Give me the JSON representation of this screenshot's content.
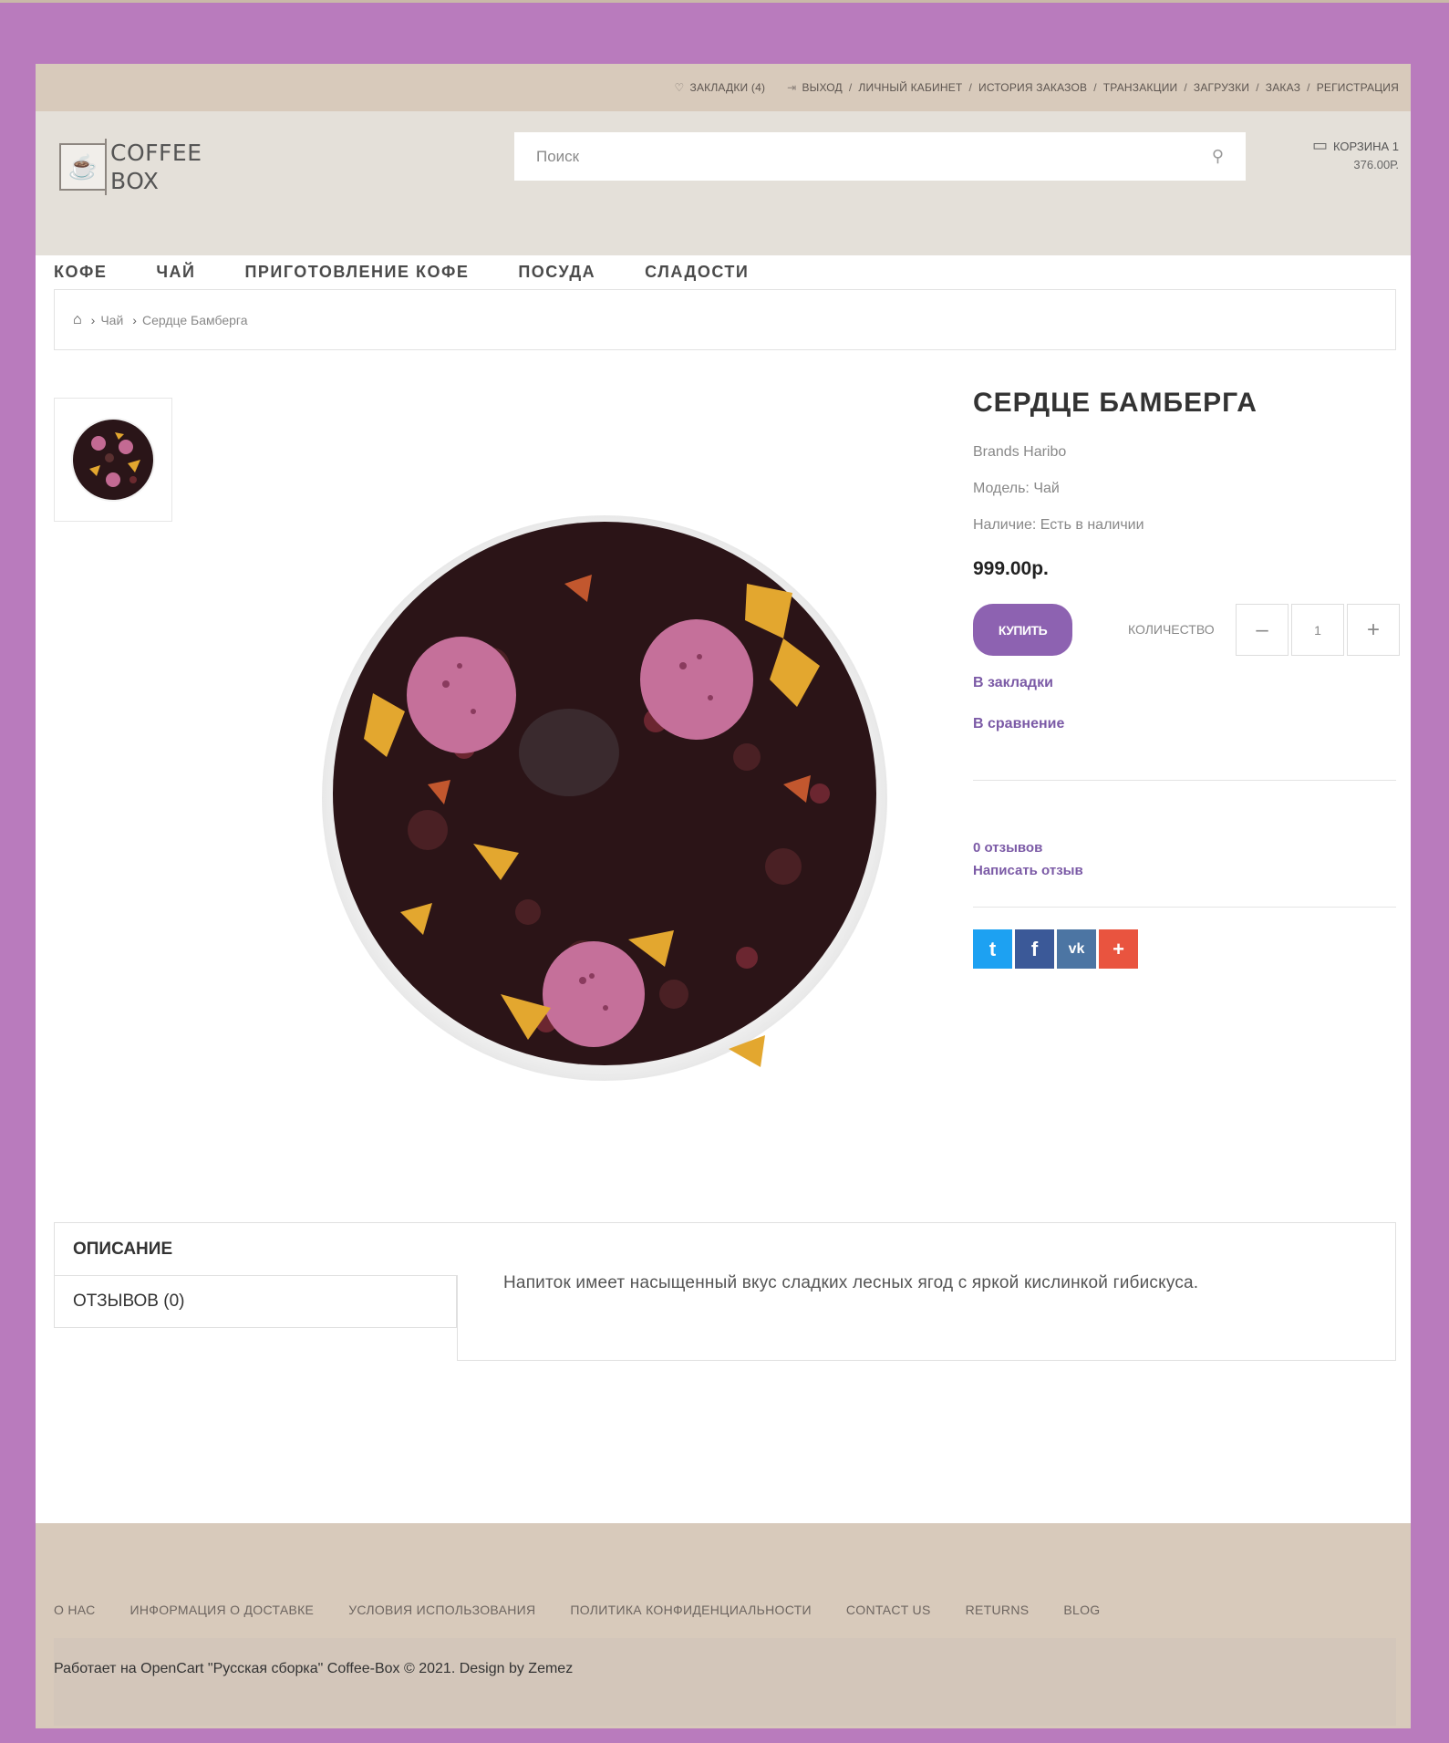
{
  "topbar": {
    "bookmarks": "ЗАКЛАДКИ (4)",
    "logout": "ВЫХОД",
    "account": "ЛИЧНЫЙ КАБИНЕТ",
    "orders": "ИСТОРИЯ ЗАКАЗОВ",
    "transactions": "ТРАНЗАКЦИИ",
    "downloads": "ЗАГРУЗКИ",
    "checkout": "ЗАКАЗ",
    "register": "РЕГИСТРАЦИЯ",
    "separator": "/"
  },
  "header": {
    "logo_line1": "COFFEE",
    "logo_line2": "BOX",
    "search_placeholder": "Поиск",
    "cart_label": "КОРЗИНА 1",
    "cart_total": "376.00Р."
  },
  "nav": [
    "КОФЕ",
    "ЧАЙ",
    "ПРИГОТОВЛЕНИЕ КОФЕ",
    "ПОСУДА",
    "СЛАДОСТИ"
  ],
  "breadcrumb": {
    "category": "Чай",
    "current": "Сердце Бамберга"
  },
  "product": {
    "title": "СЕРДЦЕ БАМБЕРГА",
    "brand": "Brands Haribo",
    "model": "Модель: Чай",
    "availability": "Наличие: Есть в наличии",
    "price": "999.00р.",
    "buy_label": "купить",
    "qty_label": "КОЛИЧЕСТВО",
    "qty_value": "1",
    "qty_minus": "–",
    "qty_plus": "+",
    "wishlist": "В закладки",
    "compare": "В сравнение",
    "reviews_count": "0 отзывов",
    "write_review": "Написать отзыв"
  },
  "social": {
    "twitter": "t",
    "facebook": "f",
    "vk": "vk",
    "more": "+"
  },
  "tabs": {
    "description": "ОПИСАНИЕ",
    "reviews": "ОТЗЫВОВ (0)",
    "description_text": "Напиток имеет насыщенный вкус сладких лесных ягод с яркой кислинкой гибискуса."
  },
  "footer": {
    "links": [
      "О НАС",
      "ИНФОРМАЦИЯ О ДОСТАВКЕ",
      "УСЛОВИЯ ИСПОЛЬЗОВАНИЯ",
      "ПОЛИТИКА КОНФИДЕНЦИАЛЬНОСТИ",
      "CONTACT US",
      "RETURNS",
      "BLOG"
    ],
    "powered": "Работает на OpenCart \"Русская сборка\" Coffee-Box © 2021. Design by Zemez"
  },
  "colors": {
    "frame": "#b97bbd",
    "topbar": "#d8cabb",
    "header": "#e4e0d9",
    "accent": "#8d62b1",
    "link": "#7b5aa6"
  }
}
